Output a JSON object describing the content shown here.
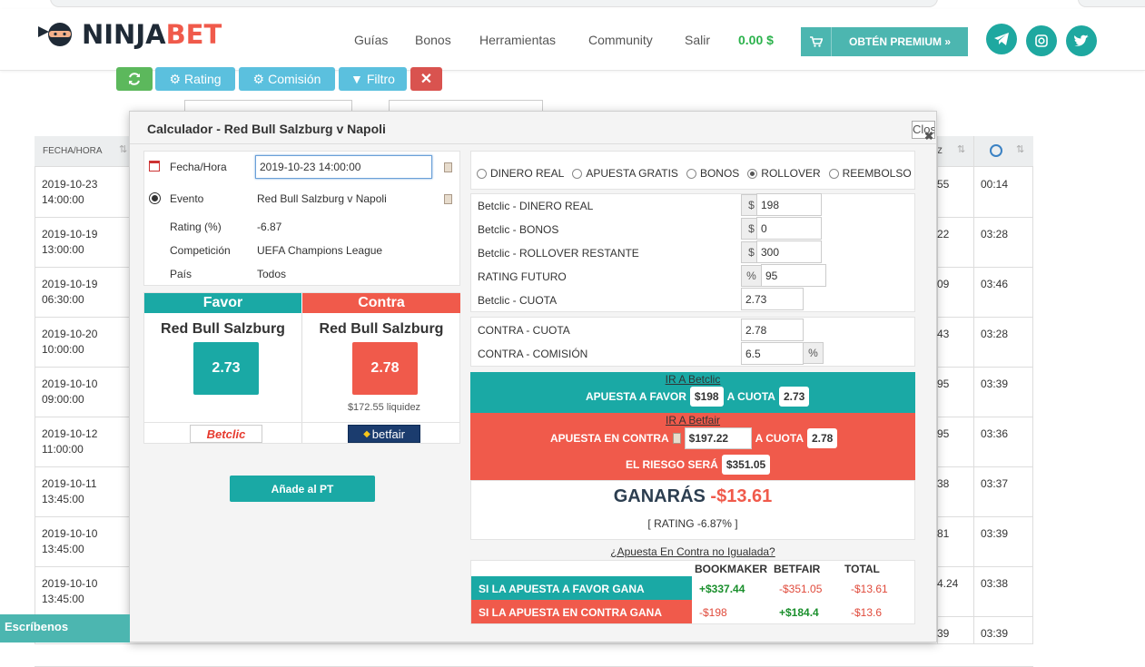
{
  "header": {
    "logo": {
      "ninja": "NINJA",
      "bet": "BET"
    },
    "nav": [
      "Guías",
      "Bonos",
      "Herramientas",
      "Community",
      "Salir"
    ],
    "balance": "0.00 $",
    "premium_label": "OBTÉN PREMIUM »",
    "socials": [
      "telegram-icon",
      "instagram-icon",
      "twitter-icon"
    ]
  },
  "toolbar": {
    "rating": "Rating",
    "comision": "Comisión",
    "filtro": "Filtro"
  },
  "table": {
    "col_fecha": "FECHA/HORA",
    "col_z_suffix": "z",
    "rows": [
      {
        "date": "2019-10-23",
        "time": "14:00:00",
        "val": "55",
        "t": "00:14"
      },
      {
        "date": "2019-10-19",
        "time": "13:00:00",
        "val": "22",
        "t": "03:28"
      },
      {
        "date": "2019-10-19",
        "time": "06:30:00",
        "val": "09",
        "t": "03:46"
      },
      {
        "date": "2019-10-20",
        "time": "10:00:00",
        "val": "43",
        "t": "03:28"
      },
      {
        "date": "2019-10-10",
        "time": "09:00:00",
        "val": "95",
        "t": "03:39"
      },
      {
        "date": "2019-10-12",
        "time": "11:00:00",
        "val": "95",
        "t": "03:36"
      },
      {
        "date": "2019-10-11",
        "time": "13:45:00",
        "val": "38",
        "t": "03:37"
      },
      {
        "date": "2019-10-10",
        "time": "13:45:00",
        "val": "81",
        "t": "03:39"
      },
      {
        "date": "2019-10-10",
        "time": "13:45:00",
        "val": "4.24",
        "t": "03:38"
      },
      {
        "date": "",
        "time": "",
        "val": "39",
        "t": "03:39"
      }
    ]
  },
  "modal": {
    "title": "Calculador - Red Bull Salzburg v Napoli",
    "close": "Close",
    "info": {
      "fecha_label": "Fecha/Hora",
      "fecha_value": "2019-10-23 14:00:00",
      "evento_label": "Evento",
      "evento_value": "Red Bull Salzburg v Napoli",
      "rating_label": "Rating (%)",
      "rating_value": "-6.87",
      "competicion_label": "Competición",
      "competicion_value": "UEFA Champions League",
      "pais_label": "País",
      "pais_value": "Todos"
    },
    "favor": {
      "header": "Favor",
      "team": "Red Bull Salzburg",
      "odd": "2.73",
      "bookmaker": "Betclic"
    },
    "contra": {
      "header": "Contra",
      "team": "Red Bull Salzburg",
      "odd": "2.78",
      "liquidez": "$172.55 liquidez",
      "exchange": "betfair"
    },
    "add_button": "Añade al PT",
    "modes": [
      {
        "label": "DINERO REAL",
        "selected": false
      },
      {
        "label": "APUESTA GRATIS",
        "selected": false
      },
      {
        "label": "BONOS",
        "selected": false
      },
      {
        "label": "ROLLOVER",
        "selected": true
      },
      {
        "label": "REEMBOLSO",
        "selected": false
      }
    ],
    "fields": [
      {
        "label": "Betclic - DINERO REAL",
        "prefix": "$",
        "value": "198"
      },
      {
        "label": "Betclic - BONOS",
        "prefix": "$",
        "value": "0"
      },
      {
        "label": "Betclic - ROLLOVER RESTANTE",
        "prefix": "$",
        "value": "300"
      },
      {
        "label": "RATING FUTURO",
        "prefix": "%",
        "value": "95"
      },
      {
        "label": "Betclic - CUOTA",
        "prefix": "",
        "value": "2.73"
      }
    ],
    "contra_fields": [
      {
        "label": "CONTRA - CUOTA",
        "value": "2.78",
        "suffix": ""
      },
      {
        "label": "CONTRA - COMISIÓN",
        "value": "6.5",
        "suffix": "%"
      }
    ],
    "favor_bet": {
      "link": "IR A Betclic",
      "text": "APUESTA A FAVOR",
      "amount": "$198",
      "cuota_text": "A CUOTA",
      "cuota": "2.73"
    },
    "contra_bet": {
      "link": "IR A Betfair",
      "text": "APUESTA EN CONTRA",
      "amount": "$197.22",
      "cuota_text": "A CUOTA",
      "cuota": "2.78",
      "riesgo_text": "EL RIESGO SERÁ",
      "riesgo": "$351.05"
    },
    "result": {
      "label": "GANARÁS",
      "value": "-$13.61",
      "rating": "[ RATING -6.87% ]"
    },
    "unmatched_link": "¿Apuesta En Contra no Igualada?",
    "summary": {
      "headers": [
        "BOOKMAKER",
        "BETFAIR",
        "TOTAL"
      ],
      "rows": [
        {
          "label": "SI LA APUESTA A FAVOR GANA",
          "bookmaker": "+$337.44",
          "betfair": "-$351.05",
          "total": "-$13.61"
        },
        {
          "label": "SI LA APUESTA EN CONTRA GANA",
          "bookmaker": "-$198",
          "betfair": "+$184.4",
          "total": "-$13.6"
        }
      ]
    }
  },
  "chat": {
    "label": "Escríbenos"
  },
  "colors": {
    "teal": "#1aa9a5",
    "red": "#f05a4b",
    "green": "#2bb24c"
  }
}
